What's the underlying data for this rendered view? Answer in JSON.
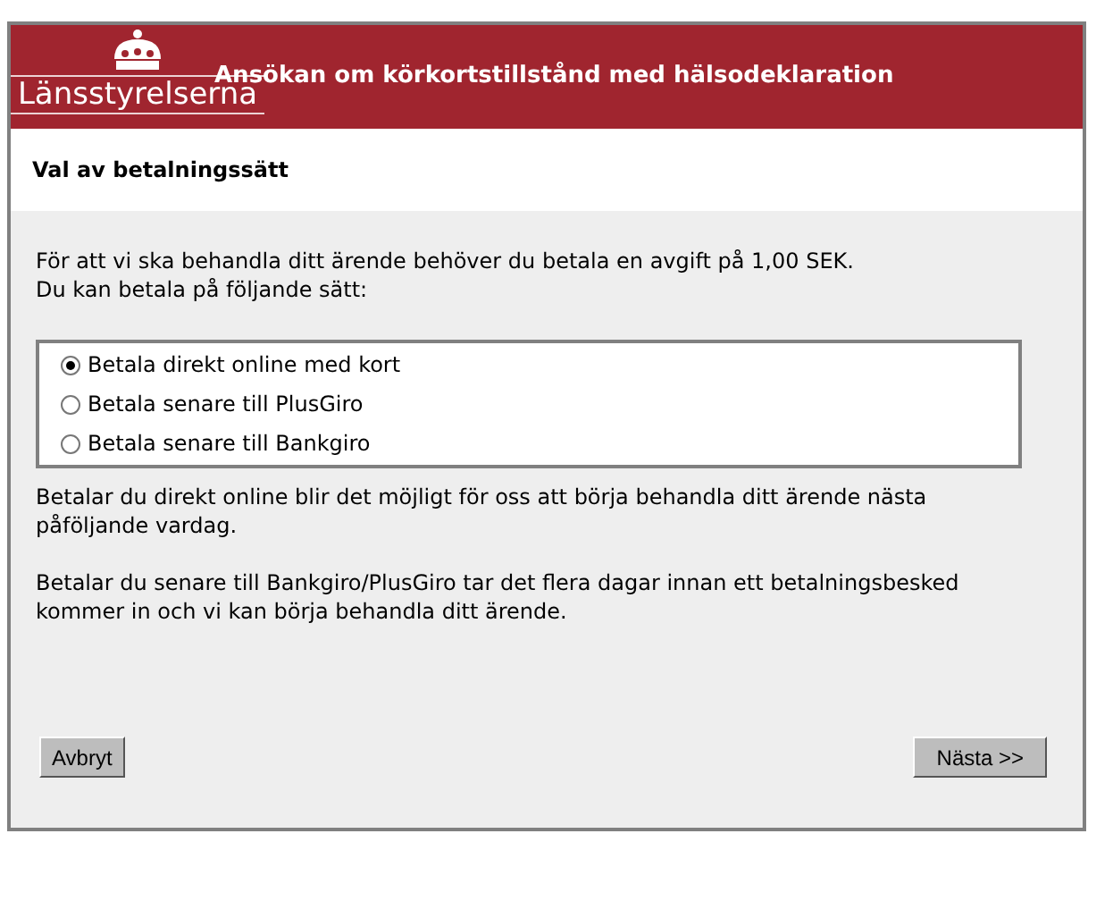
{
  "header": {
    "logo_text": "Länsstyrelserna",
    "title": "Ansökan om körkortstillstånd med hälsodeklaration"
  },
  "section_title": "Val av betalningssätt",
  "intro": [
    "För att vi ska behandla ditt ärende behöver du betala en avgift på 1,00 SEK.",
    "Du kan betala på följande sätt:"
  ],
  "options": [
    {
      "label": "Betala direkt online med kort",
      "selected": true
    },
    {
      "label": "Betala senare till PlusGiro",
      "selected": false
    },
    {
      "label": "Betala senare till Bankgiro",
      "selected": false
    }
  ],
  "notes": [
    "Betalar du direkt online blir det möjligt för oss att börja behandla ditt ärende nästa påföljande vardag.",
    "Betalar du senare till Bankgiro/PlusGiro tar det flera dagar innan ett betalningsbesked kommer in och vi kan börja behandla ditt ärende."
  ],
  "buttons": {
    "cancel": "Avbryt",
    "next": "Nästa >>"
  }
}
